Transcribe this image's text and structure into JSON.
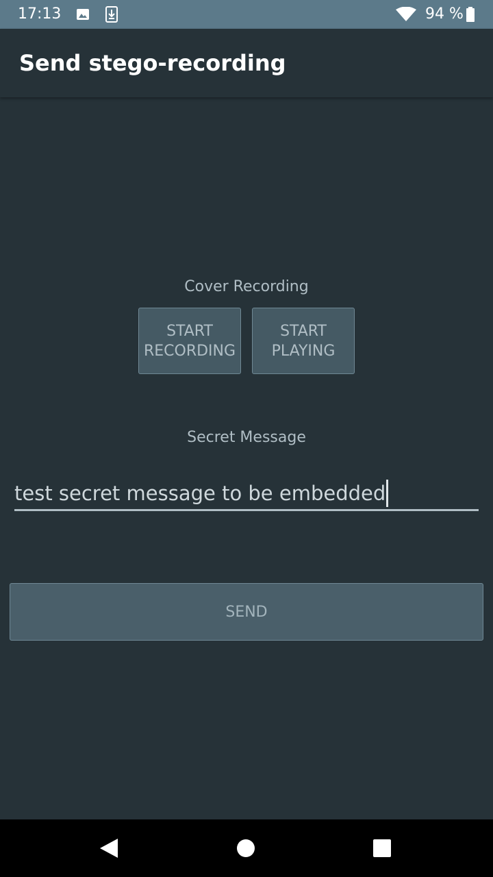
{
  "status_bar": {
    "time": "17:13",
    "battery_text": "94 %",
    "icons": [
      "image-icon",
      "download-icon",
      "wifi-icon",
      "battery-icon"
    ]
  },
  "app_bar": {
    "title": "Send stego-recording"
  },
  "cover_section": {
    "label": "Cover Recording",
    "start_recording_line1": "START",
    "start_recording_line2": "RECORDING",
    "start_playing_line1": "START",
    "start_playing_line2": "PLAYING"
  },
  "secret_section": {
    "label": "Secret Message",
    "input_value": "test secret message to be embedded"
  },
  "send_button": {
    "label": "SEND"
  },
  "nav_bar": {
    "icons": [
      "back-icon",
      "home-icon",
      "recents-icon"
    ]
  },
  "colors": {
    "background": "#263238",
    "status_bar": "#5c7a8a",
    "button": "#455a64",
    "text_secondary": "#b0bec5"
  }
}
